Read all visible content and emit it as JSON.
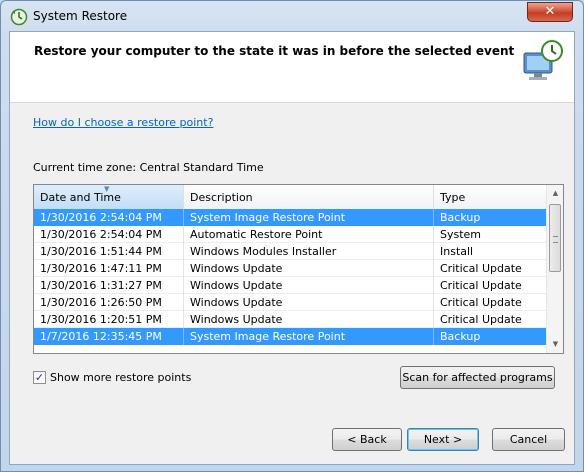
{
  "window": {
    "title": "System Restore",
    "close_label": "✕"
  },
  "header": {
    "title": "Restore your computer to the state it was in before the selected event"
  },
  "help_link": "How do I choose a restore point?",
  "timezone": "Current time zone: Central Standard Time",
  "table": {
    "columns": [
      "Date and Time",
      "Description",
      "Type"
    ],
    "rows": [
      {
        "date": "1/30/2016 2:54:04 PM",
        "desc": "System Image Restore Point",
        "type": "Backup",
        "selected": true
      },
      {
        "date": "1/30/2016 2:54:04 PM",
        "desc": "Automatic Restore Point",
        "type": "System",
        "selected": false
      },
      {
        "date": "1/30/2016 1:51:44 PM",
        "desc": "Windows Modules Installer",
        "type": "Install",
        "selected": false
      },
      {
        "date": "1/30/2016 1:47:11 PM",
        "desc": "Windows Update",
        "type": "Critical Update",
        "selected": false
      },
      {
        "date": "1/30/2016 1:31:27 PM",
        "desc": "Windows Update",
        "type": "Critical Update",
        "selected": false
      },
      {
        "date": "1/30/2016 1:26:50 PM",
        "desc": "Windows Update",
        "type": "Critical Update",
        "selected": false
      },
      {
        "date": "1/30/2016 1:20:51 PM",
        "desc": "Windows Update",
        "type": "Critical Update",
        "selected": false
      },
      {
        "date": "1/7/2016 12:35:45 PM",
        "desc": "System Image Restore Point",
        "type": "Backup",
        "selected": true
      }
    ]
  },
  "show_more": {
    "label": "Show more restore points",
    "checked": true
  },
  "buttons": {
    "scan": "Scan for affected programs",
    "back": "< Back",
    "next": "Next >",
    "cancel": "Cancel"
  },
  "colors": {
    "selection": "#3399ff",
    "link": "#0066cc",
    "close": "#c43c22"
  },
  "icons": [
    "system-restore-icon",
    "close-icon",
    "restore-computer-icon",
    "sort-arrow-icon",
    "scroll-up-icon",
    "scroll-down-icon",
    "checkbox-checked-icon"
  ]
}
